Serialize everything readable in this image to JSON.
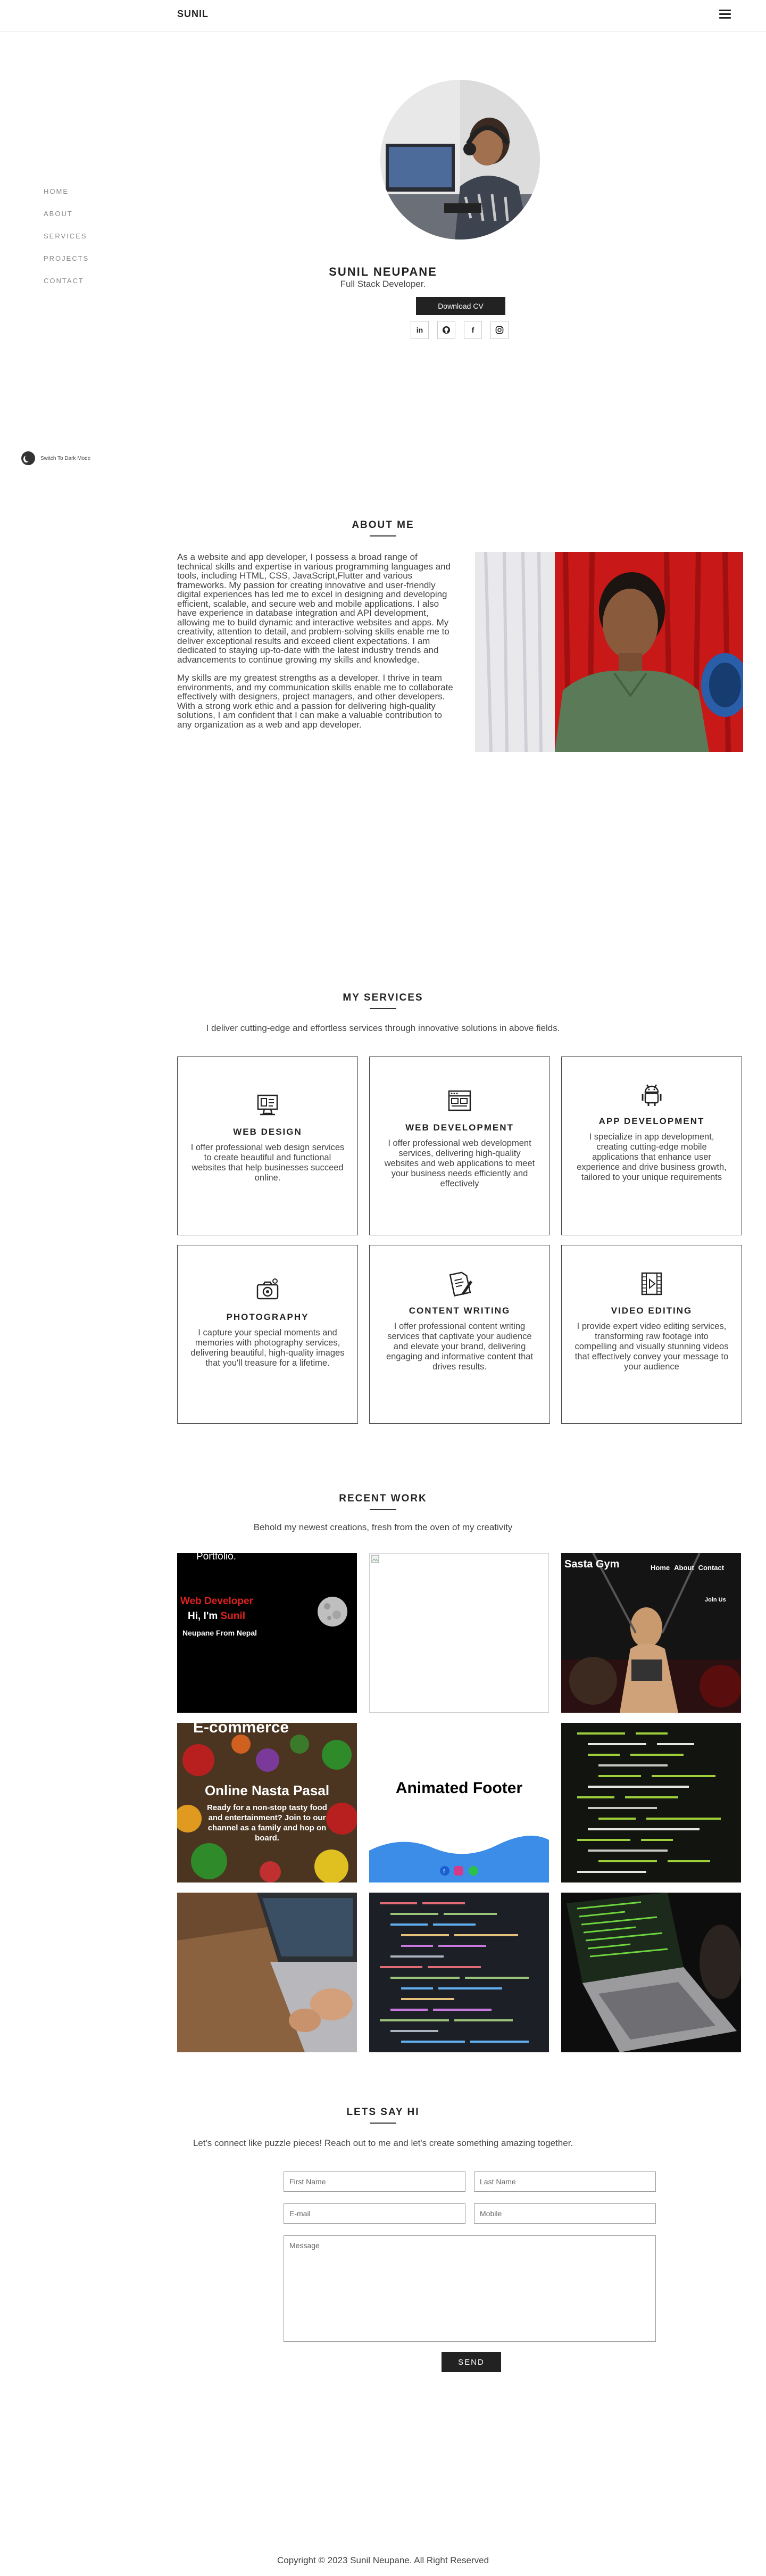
{
  "header": {
    "brand": "SUNIL"
  },
  "nav": {
    "items": [
      "HOME",
      "ABOUT",
      "SERVICES",
      "PROJECTS",
      "CONTACT"
    ]
  },
  "darkmode": {
    "label": "Switch To Dark Mode"
  },
  "hero": {
    "name": "SUNIL NEUPANE",
    "role": "Full Stack Developer.",
    "cv_button": "Download CV",
    "socials": [
      "in",
      "github",
      "f",
      "instagram"
    ]
  },
  "about": {
    "title": "ABOUT ME",
    "paragraphs": [
      "As a website and app developer, I possess a broad range of technical skills and expertise in various programming languages and tools, including HTML, CSS, JavaScript,Flutter and various frameworks. My passion for creating innovative and user-friendly digital experiences has led me to excel in designing and developing efficient, scalable, and secure web and mobile applications. I also have experience in database integration and API development, allowing me to build dynamic and interactive websites and apps. My creativity, attention to detail, and problem-solving skills enable me to deliver exceptional results and exceed client expectations. I am dedicated to staying up-to-date with the latest industry trends and advancements to continue growing my skills and knowledge.",
      "My skills are my greatest strengths as a developer. I thrive in team environments, and my communication skills enable me to collaborate effectively with designers, project managers, and other developers. With a strong work ethic and a passion for delivering high-quality solutions, I am confident that I can make a valuable contribution to any organization as a web and app developer."
    ]
  },
  "services": {
    "title": "MY SERVICES",
    "subtitle": "I deliver cutting-edge and effortless services through innovative solutions in above fields.",
    "items": [
      {
        "icon": "monitor-icon",
        "title": "WEB DESIGN",
        "desc": "I offer professional web design services to create beautiful and functional websites that help businesses succeed online."
      },
      {
        "icon": "browser-window-icon",
        "title": "WEB DEVELOPMENT",
        "desc": "I offer professional web development services, delivering high-quality websites and web applications to meet your business needs efficiently and effectively"
      },
      {
        "icon": "android-icon",
        "title": "APP DEVELOPMENT",
        "desc": "I specialize in app development, creating cutting-edge mobile applications that enhance user experience and drive business growth, tailored to your unique requirements"
      },
      {
        "icon": "camera-icon",
        "title": "PHOTOGRAPHY",
        "desc": "I capture your special moments and memories with photography services, delivering beautiful, high-quality images that you'll treasure for a lifetime."
      },
      {
        "icon": "document-pen-icon",
        "title": "CONTENT WRITING",
        "desc": "I offer professional content writing services that captivate your audience and elevate your brand, delivering engaging and informative content that drives results."
      },
      {
        "icon": "film-play-icon",
        "title": "VIDEO EDITING",
        "desc": "I provide expert video editing services, transforming raw footage into compelling and visually stunning videos that effectively convey your message to your audience"
      }
    ]
  },
  "work": {
    "title": "RECENT WORK",
    "subtitle": "Behold my newest creations, fresh from the oven of my creativity",
    "portfolio": {
      "top": "Portfolio.",
      "line1": "Web Developer",
      "line2a": "Hi, I'm ",
      "line2b": "Sunil",
      "line3": "Neupane From Nepal"
    },
    "gym": {
      "logo": "Sasta Gym",
      "nav": [
        "Home",
        "About",
        "Contact"
      ],
      "cta": "Join Us"
    },
    "ecommerce": {
      "header": "E-commerce",
      "title": "Online Nasta Pasal",
      "text": "Ready for a non-stop tasty food and entertainment? Join to our channel as a family and hop on board."
    },
    "footer_demo": {
      "title": "Animated Footer"
    }
  },
  "contact": {
    "title": "LETS SAY HI",
    "subtitle": "Let's connect like puzzle pieces! Reach out to me and let's create something amazing together.",
    "first_name": "First Name",
    "last_name": "Last Name",
    "email": "E-mail",
    "mobile": "Mobile",
    "message": "Message",
    "send": "SEND"
  },
  "footer": {
    "copyright": "Copyright © 2023 Sunil Neupane. All Right Reserved"
  }
}
